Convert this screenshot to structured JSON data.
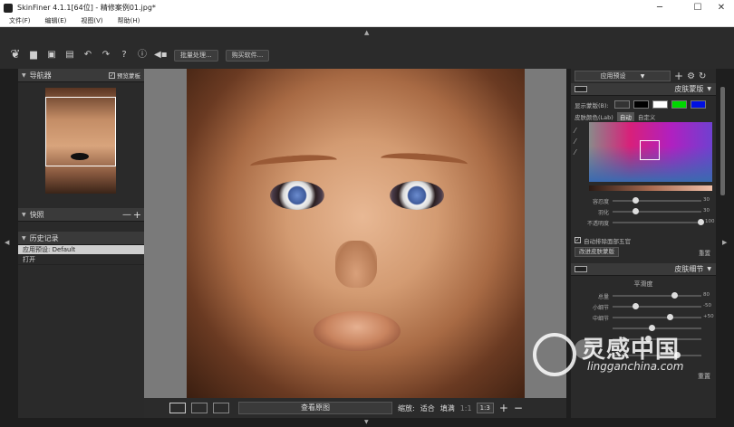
{
  "window": {
    "title": "SkinFiner 4.1.1[64位] - 精修案例01.jpg*"
  },
  "menu": [
    {
      "label": "文件(F)"
    },
    {
      "label": "编辑(E)"
    },
    {
      "label": "视图(V)"
    },
    {
      "label": "帮助(H)"
    }
  ],
  "toolbar": {
    "batch_label": "批量处理...",
    "buy_label": "购买软件..."
  },
  "navigator": {
    "title": "导航器",
    "preview_mask": "预览蒙板"
  },
  "snapshot": {
    "title": "快照"
  },
  "history": {
    "title": "历史记录",
    "items": [
      {
        "label": "应用预设: Default"
      },
      {
        "label": "打开"
      }
    ]
  },
  "bottom": {
    "view_original": "查看原图",
    "zoom_label": "缩放:",
    "fit": "适合",
    "fill": "填满",
    "one_to_one": "1:1",
    "ratio": "1:3"
  },
  "right_panel": {
    "preset_label": "应用预设",
    "skin_mask": {
      "title": "皮肤蒙版",
      "show_mask": "显示蒙版(B):",
      "skin_color": "皮肤颜色(Lab)",
      "auto": "自动",
      "custom": "自定义",
      "sliders": [
        {
          "label": "容忍度",
          "value": "30",
          "pos": 0.25
        },
        {
          "label": "羽化",
          "value": "30",
          "pos": 0.25
        },
        {
          "label": "不透明度",
          "value": "100",
          "pos": 0.97
        }
      ],
      "auto_exclude": "自动排除面部五官",
      "improve_button": "改进皮肤蒙版",
      "reset": "重置"
    },
    "skin_detail": {
      "title": "皮肤细节",
      "smoothness": "平滑度",
      "sliders": [
        {
          "label": "总量",
          "value": "80",
          "pos": 0.72
        },
        {
          "label": "小细节",
          "value": "-50",
          "pos": 0.25
        },
        {
          "label": "中细节",
          "value": "+50",
          "pos": 0.65
        },
        {
          "label": "",
          "value": "",
          "pos": 0.45
        },
        {
          "label": "",
          "value": "",
          "pos": 0.4
        },
        {
          "label": "",
          "value": "",
          "pos": 0.5
        }
      ],
      "reset": "重置"
    }
  },
  "watermark": {
    "cn": "灵感中国",
    "en": "lingganchina.com"
  }
}
